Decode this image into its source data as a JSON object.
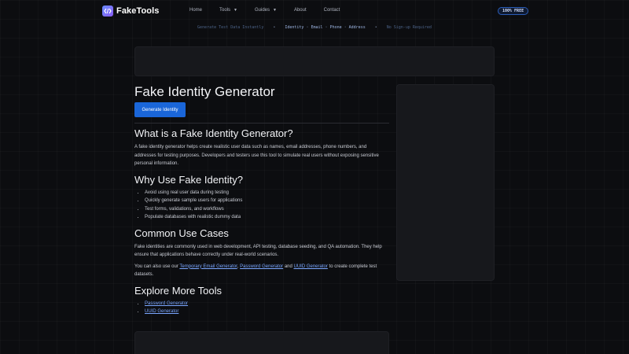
{
  "header": {
    "logo_text": "FakeTools",
    "nav": [
      {
        "label": "Home",
        "has_caret": false
      },
      {
        "label": "Tools",
        "has_caret": true
      },
      {
        "label": "Guides",
        "has_caret": true
      },
      {
        "label": "About",
        "has_caret": false
      },
      {
        "label": "Contact",
        "has_caret": false
      }
    ],
    "badge": "100% FREE"
  },
  "ticker": {
    "item1": "Generate Test Data Instantly",
    "item2": "Identity · Email · Phone · Address",
    "item3": "No Sign-up Required"
  },
  "main": {
    "title": "Fake Identity Generator",
    "generate_button": "Generate Identity",
    "sections": {
      "what": {
        "heading": "What is a Fake Identity Generator?",
        "body": "A fake identity generator helps create realistic user data such as names, email addresses, phone numbers, and addresses for testing purposes. Developers and testers use this tool to simulate real users without exposing sensitive personal information."
      },
      "why": {
        "heading": "Why Use Fake Identity?",
        "items": [
          "Avoid using real user data during testing",
          "Quickly generate sample users for applications",
          "Test forms, validations, and workflows",
          "Populate databases with realistic dummy data"
        ]
      },
      "common": {
        "heading": "Common Use Cases",
        "body": "Fake identities are commonly used in web development, API testing, database seeding, and QA automation. They help ensure that applications behave correctly under real-world scenarios.",
        "also_prefix": "You can also use our",
        "link1": "Temporary Email Generator",
        "sep1": ",",
        "link2": "Password Generator",
        "sep2": "and",
        "link3": "UUID Generator",
        "also_suffix": "to create complete test datasets."
      },
      "explore": {
        "heading": "Explore More Tools",
        "links": [
          "Password Generator",
          "UUID Generator"
        ]
      }
    }
  },
  "icons": {
    "logo": "code-brackets-icon",
    "caret": "chevron-down-icon"
  },
  "colors": {
    "background": "#0c0d10",
    "accent": "#1a66d9",
    "link": "#7aa6ff",
    "panel": "#17181c"
  }
}
